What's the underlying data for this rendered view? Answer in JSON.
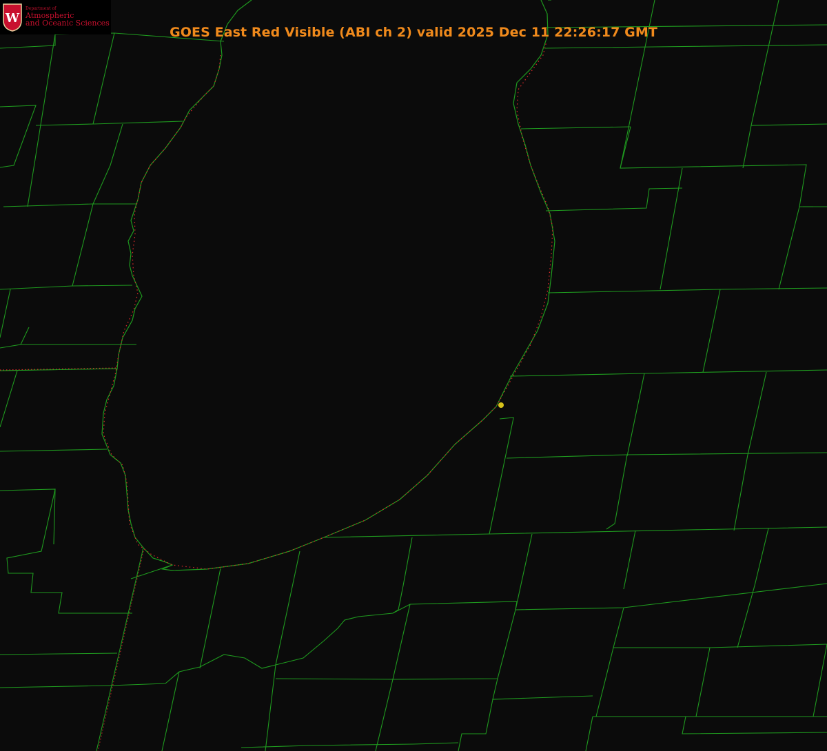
{
  "title": "GOES East Red Visible (ABI ch 2) valid 2025 Dec 11 22:26:17 GMT",
  "logo": {
    "seal_letter": "W",
    "department": "Department of",
    "line1": "Atmospheric",
    "line2": "and Oceanic Sciences"
  },
  "colors": {
    "background": "#0b0b0b",
    "county_lines": "#1f9a1f",
    "coastline_dots": "#d42a2a",
    "title": "#f08a1c",
    "marker": "#d6c21a",
    "logo_text": "#c8102e"
  },
  "icons": {
    "seal": "uw-seal-icon",
    "marker": "location-dot-icon"
  }
}
